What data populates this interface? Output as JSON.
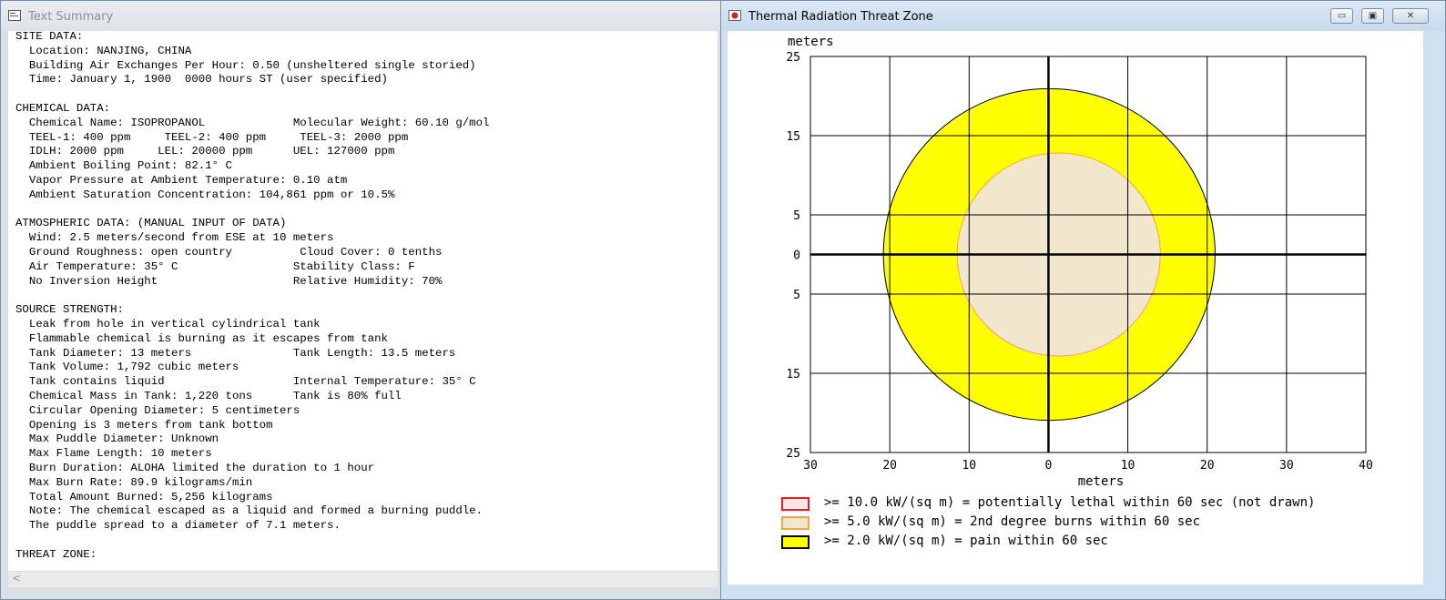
{
  "text_window": {
    "title": "Text Summary",
    "lines": [
      "SITE DATA:",
      "  Location: NANJING, CHINA",
      "  Building Air Exchanges Per Hour: 0.50 (unsheltered single storied)",
      "  Time: January 1, 1900  0000 hours ST (user specified)",
      "",
      "CHEMICAL DATA:",
      "  Chemical Name: ISOPROPANOL             Molecular Weight: 60.10 g/mol",
      "  TEEL-1: 400 ppm     TEEL-2: 400 ppm     TEEL-3: 2000 ppm",
      "  IDLH: 2000 ppm     LEL: 20000 ppm      UEL: 127000 ppm",
      "  Ambient Boiling Point: 82.1° C",
      "  Vapor Pressure at Ambient Temperature: 0.10 atm",
      "  Ambient Saturation Concentration: 104,861 ppm or 10.5%",
      "",
      "ATMOSPHERIC DATA: (MANUAL INPUT OF DATA)",
      "  Wind: 2.5 meters/second from ESE at 10 meters",
      "  Ground Roughness: open country          Cloud Cover: 0 tenths",
      "  Air Temperature: 35° C                 Stability Class: F",
      "  No Inversion Height                    Relative Humidity: 70%",
      "",
      "SOURCE STRENGTH:",
      "  Leak from hole in vertical cylindrical tank",
      "  Flammable chemical is burning as it escapes from tank",
      "  Tank Diameter: 13 meters               Tank Length: 13.5 meters",
      "  Tank Volume: 1,792 cubic meters",
      "  Tank contains liquid                   Internal Temperature: 35° C",
      "  Chemical Mass in Tank: 1,220 tons      Tank is 80% full",
      "  Circular Opening Diameter: 5 centimeters",
      "  Opening is 3 meters from tank bottom",
      "  Max Puddle Diameter: Unknown",
      "  Max Flame Length: 10 meters",
      "  Burn Duration: ALOHA limited the duration to 1 hour",
      "  Max Burn Rate: 89.9 kilograms/min",
      "  Total Amount Burned: 5,256 kilograms",
      "  Note: The chemical escaped as a liquid and formed a burning puddle.",
      "  The puddle spread to a diameter of 7.1 meters.",
      "",
      "THREAT ZONE:"
    ],
    "scroll_left": "<"
  },
  "plot_window": {
    "title": "Thermal Radiation Threat Zone",
    "buttons": {
      "minimize": "▭",
      "maximize": "▣",
      "close": "✕"
    }
  },
  "chart_data": {
    "type": "scatter",
    "title": "",
    "xlabel": "meters",
    "ylabel": "meters",
    "x_ticks": [
      "30",
      "20",
      "10",
      "0",
      "10",
      "20",
      "30",
      "40"
    ],
    "y_ticks": [
      "25",
      "15",
      "5",
      "0",
      "5",
      "15",
      "25"
    ],
    "xlim": [
      -30,
      40
    ],
    "ylim": [
      -25,
      25
    ],
    "grid": true,
    "zones": [
      {
        "threshold_kw_sqm": 10.0,
        "label": ">= 10.0 kW/(sq m) = potentially lethal within 60 sec (not drawn)",
        "drawn": false,
        "color": "#e02020",
        "fill": "#f7e4e4"
      },
      {
        "threshold_kw_sqm": 5.0,
        "label": ">= 5.0 kW/(sq m) = 2nd degree burns within 60 sec",
        "drawn": true,
        "radius_m": 12.8,
        "center": [
          1.3,
          0
        ],
        "color": "#f2a64b",
        "fill": "#f2e6cc"
      },
      {
        "threshold_kw_sqm": 2.0,
        "label": ">= 2.0 kW/(sq m) = pain within 60 sec",
        "drawn": true,
        "radius_m": 20.9,
        "center": [
          0.1,
          0
        ],
        "color": "#000000",
        "fill": "#ffff00"
      }
    ]
  }
}
